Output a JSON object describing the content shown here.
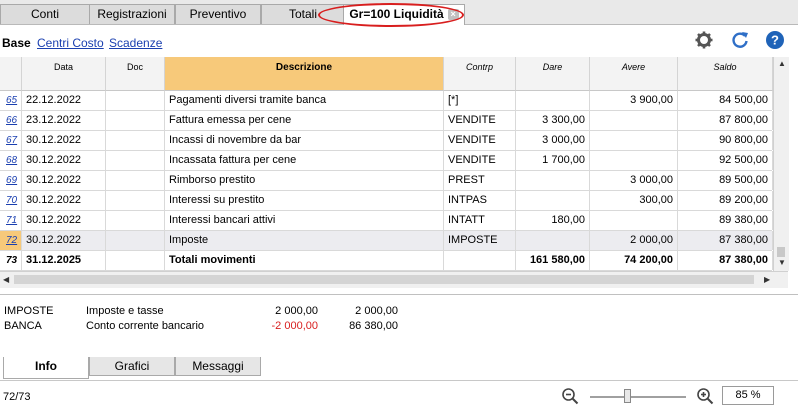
{
  "tabs": [
    {
      "label": "Conti"
    },
    {
      "label": "Registrazioni"
    },
    {
      "label": "Preventivo"
    },
    {
      "label": "Totali"
    },
    {
      "label": "Gr=100 Liquidità"
    }
  ],
  "tab_close": "×",
  "views": [
    {
      "label": "Base"
    },
    {
      "label": "Centri Costo"
    },
    {
      "label": "Scadenze"
    }
  ],
  "toolbar_icons": [
    "gear-icon",
    "refresh-icon",
    "help-icon"
  ],
  "columns": [
    "Data",
    "Doc",
    "Descrizione",
    "Contrp",
    "Dare",
    "Avere",
    "Saldo"
  ],
  "rows": [
    {
      "n": "65",
      "date": "22.12.2022",
      "doc": "",
      "desc": "Pagamenti diversi tramite banca",
      "contrp": "[*]",
      "dare": "",
      "avere": "3 900,00",
      "saldo": "84 500,00"
    },
    {
      "n": "66",
      "date": "23.12.2022",
      "doc": "",
      "desc": "Fattura emessa per cene",
      "contrp": "VENDITE",
      "dare": "3 300,00",
      "avere": "",
      "saldo": "87 800,00"
    },
    {
      "n": "67",
      "date": "30.12.2022",
      "doc": "",
      "desc": "Incassi di novembre da bar",
      "contrp": "VENDITE",
      "dare": "3 000,00",
      "avere": "",
      "saldo": "90 800,00"
    },
    {
      "n": "68",
      "date": "30.12.2022",
      "doc": "",
      "desc": "Incassata fattura per cene",
      "contrp": "VENDITE",
      "dare": "1 700,00",
      "avere": "",
      "saldo": "92 500,00"
    },
    {
      "n": "69",
      "date": "30.12.2022",
      "doc": "",
      "desc": "Rimborso prestito",
      "contrp": "PREST",
      "dare": "",
      "avere": "3 000,00",
      "saldo": "89 500,00"
    },
    {
      "n": "70",
      "date": "30.12.2022",
      "doc": "",
      "desc": "Interessi su prestito",
      "contrp": "INTPAS",
      "dare": "",
      "avere": "300,00",
      "saldo": "89 200,00"
    },
    {
      "n": "71",
      "date": "30.12.2022",
      "doc": "",
      "desc": "Interessi bancari attivi",
      "contrp": "INTATT",
      "dare": "180,00",
      "avere": "",
      "saldo": "89 380,00"
    },
    {
      "n": "72",
      "date": "30.12.2022",
      "doc": "",
      "desc": "Imposte",
      "contrp": "IMPOSTE",
      "dare": "",
      "avere": "2 000,00",
      "saldo": "87 380,00"
    },
    {
      "n": "73",
      "date": "31.12.2025",
      "doc": "",
      "desc": "Totali movimenti",
      "contrp": "",
      "dare": "161 580,00",
      "avere": "74 200,00",
      "saldo": "87 380,00"
    }
  ],
  "info": [
    {
      "account": "IMPOSTE",
      "desc": "Imposte e tasse",
      "amount": "2 000,00",
      "balance": "2 000,00"
    },
    {
      "account": "BANCA",
      "desc": "Conto corrente bancario",
      "amount": "-2 000,00",
      "balance": "86 380,00"
    }
  ],
  "bottom_tabs": [
    {
      "label": "Info"
    },
    {
      "label": "Grafici"
    },
    {
      "label": "Messaggi"
    }
  ],
  "status": {
    "position": "72/73",
    "zoom": "85 %",
    "zoom_out": "−",
    "zoom_in": "+"
  },
  "colors": {
    "highlight": "#f7c97a",
    "link": "#1a3fb0",
    "negative": "#d81e1e",
    "oval": "#d81e1e"
  }
}
